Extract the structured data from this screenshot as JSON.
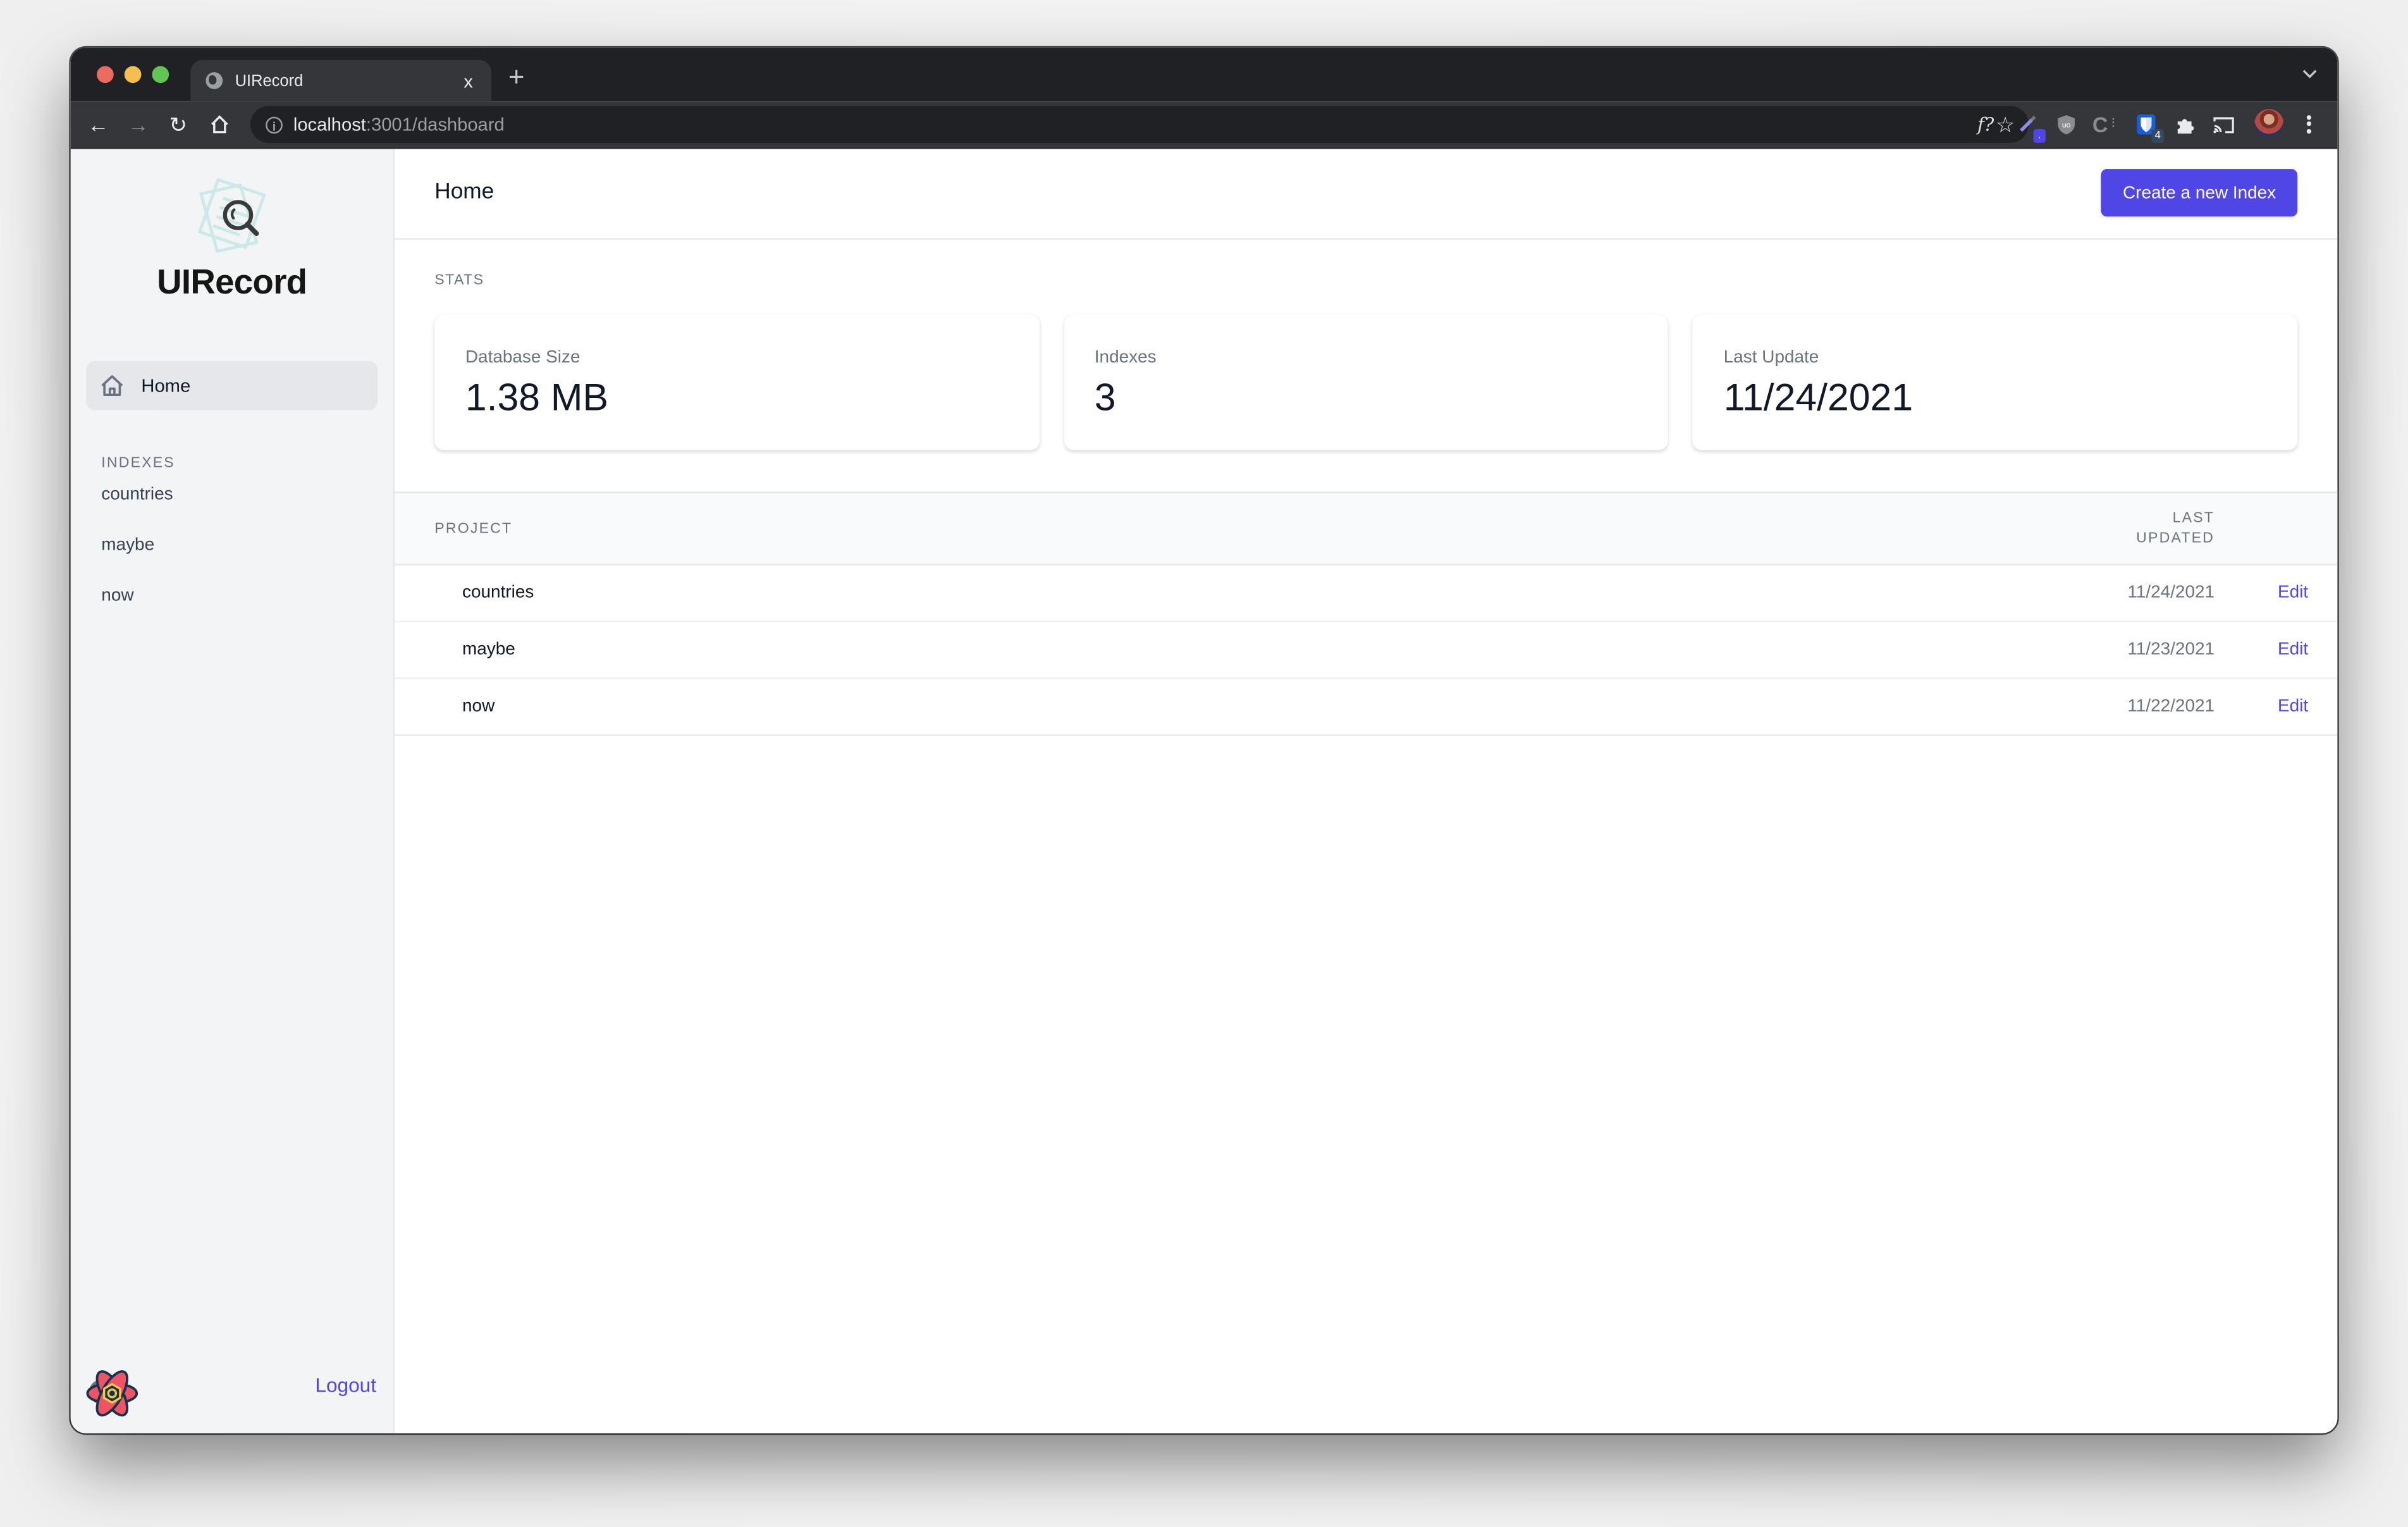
{
  "browser": {
    "tab_title": "UIRecord",
    "tab_close": "x",
    "new_tab": "+",
    "url_host": "localhost",
    "url_rest": ":3001/dashboard",
    "extensions": [
      {
        "name": "formula-extension",
        "label": "f?"
      },
      {
        "name": "color-picker-extension",
        "badge": "."
      },
      {
        "name": "ublock-extension",
        "label": "uo"
      },
      {
        "name": "c-extension",
        "label": "C"
      },
      {
        "name": "bitwarden-extension",
        "badge": "4"
      },
      {
        "name": "extensions-puzzle"
      },
      {
        "name": "cast"
      }
    ],
    "colors": {
      "tabstrip": "#202124",
      "toolbar": "#35363a"
    }
  },
  "sidebar": {
    "logo_text": "UIRecord",
    "home_label": "Home",
    "section_label": "INDEXES",
    "indexes": [
      "countries",
      "maybe",
      "now"
    ],
    "logout_label": "Logout"
  },
  "header": {
    "title": "Home",
    "create_button": "Create a new Index"
  },
  "stats": {
    "section_label": "STATS",
    "cards": [
      {
        "label": "Database Size",
        "value": "1.38 MB"
      },
      {
        "label": "Indexes",
        "value": "3"
      },
      {
        "label": "Last Update",
        "value": "11/24/2021"
      }
    ]
  },
  "table": {
    "columns": {
      "project": "PROJECT",
      "last_updated_line1": "LAST",
      "last_updated_line2": "UPDATED"
    },
    "rows": [
      {
        "name": "countries",
        "date": "11/24/2021",
        "action": "Edit"
      },
      {
        "name": "maybe",
        "date": "11/23/2021",
        "action": "Edit"
      },
      {
        "name": "now",
        "date": "11/22/2021",
        "action": "Edit"
      }
    ]
  },
  "theme": {
    "accent": "#4f46e5",
    "sidebar_bg": "#f3f4f6"
  }
}
